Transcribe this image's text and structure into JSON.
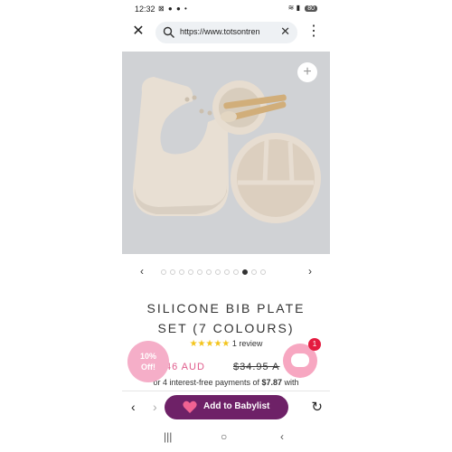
{
  "status": {
    "time": "12:32",
    "battery": "80"
  },
  "browser": {
    "url": "https://www.totsontren",
    "close_icon": "close-icon",
    "search_icon": "search-icon"
  },
  "carousel": {
    "total": 12,
    "active_index": 9
  },
  "product": {
    "title_line1": "SILICONE BIB PLATE",
    "title_line2": "SET (7 COLOURS)",
    "stars": "★★★★★",
    "reviews": "1 review",
    "price": "46 AUD",
    "compare_price": "$34.95 A",
    "afterpay_prefix": "or 4 interest-free payments of ",
    "afterpay_amount": "$7.87",
    "afterpay_suffix": " with"
  },
  "promo": {
    "line1": "10%",
    "line2": "Off!"
  },
  "chat": {
    "badge": "1"
  },
  "toolbar": {
    "babylist_label": "Add to Babylist"
  },
  "colors": {
    "accent": "#6e2167",
    "pink": "#e05c8c",
    "star": "#f3c41c"
  }
}
